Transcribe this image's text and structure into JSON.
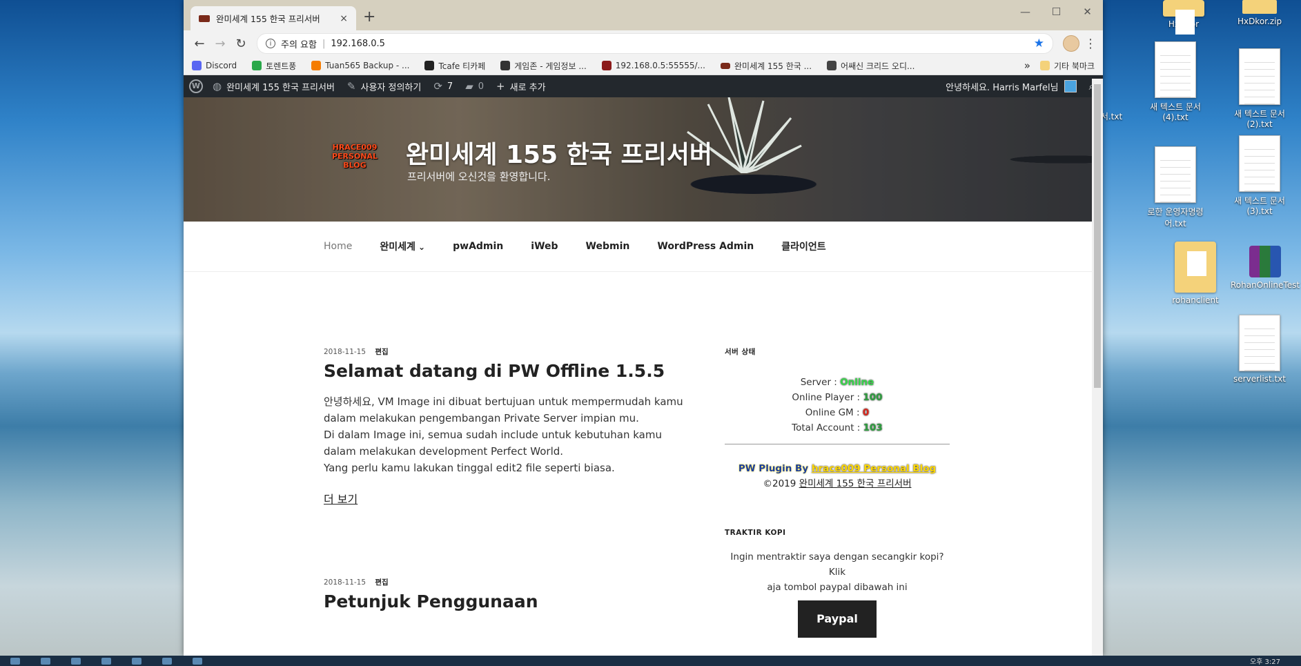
{
  "browser": {
    "tab_title": "완미세계 155 한국 프리서버",
    "tab_close": "×",
    "new_tab": "+",
    "url_warning": "주의 요함",
    "url": "192.168.0.5",
    "minimize": "—",
    "maximize": "☐",
    "close": "✕"
  },
  "bookmarks": {
    "items": [
      {
        "label": "Discord",
        "color": "#5865f2"
      },
      {
        "label": "토렌트풍",
        "color": "#2aa84a"
      },
      {
        "label": "Tuan565 Backup - ...",
        "color": "#f57c00"
      },
      {
        "label": "Tcafe 티카페",
        "color": "#222222"
      },
      {
        "label": "게임존 - 게임정보 ...",
        "color": "#333333"
      },
      {
        "label": "192.168.0.5:55555/...",
        "color": "#8b1a1a"
      },
      {
        "label": "완미세계 155 한국 ...",
        "color": "#7a2a1a"
      },
      {
        "label": "어쌔신 크리드 오디...",
        "color": "#444444"
      }
    ],
    "more": "»",
    "other": "기타 북마크"
  },
  "adminbar": {
    "site": "완미세계 155 한국 프리서버",
    "customize": "사용자 정의하기",
    "updates": "7",
    "comments": "0",
    "new": "새로 추가",
    "greeting": "안녕하세요. Harris Marfel님"
  },
  "header": {
    "logo_line1": "HRACE009",
    "logo_line2": "PERSONAL",
    "logo_line3": "BLOG",
    "title": "완미세계 155 한국 프리서버",
    "description": "프리서버에 오신것을 환영합니다."
  },
  "nav": [
    "Home",
    "완미세계",
    "pwAdmin",
    "iWeb",
    "Webmin",
    "WordPress Admin",
    "클라이언트"
  ],
  "posts": [
    {
      "date": "2018-11-15",
      "edit": "편집",
      "title": "Selamat datang di PW Offline 1.5.5",
      "lines": [
        "안녕하세요, VM Image ini dibuat bertujuan untuk mempermudah kamu",
        "dalam melakukan pengembangan Private Server impian mu.",
        "Di dalam Image ini, semua sudah include untuk kebutuhan kamu",
        "dalam melakukan development Perfect World.",
        "Yang perlu kamu lakukan tinggal edit2 file seperti biasa."
      ],
      "more": "더 보기"
    },
    {
      "date": "2018-11-15",
      "edit": "편집",
      "title": "Petunjuk Penggunaan"
    }
  ],
  "sidebar": {
    "status_title": "서버 상태",
    "server_label": "Server : ",
    "server_value": "Online",
    "player_label": "Online Player : ",
    "player_value": "100",
    "gm_label": "Online GM : ",
    "gm_value": "0",
    "account_label": "Total Account : ",
    "account_value": "103",
    "plugin_prefix": "PW Plugin By ",
    "plugin_link": "hrace009 Personal Blog",
    "copyright_prefix": "©2019 ",
    "copyright_link": "완미세계 155 한국 프리서버",
    "kopi_title": "TRAKTIR KOPI",
    "kopi_line1": "Ingin mentraktir saya dengan secangkir kopi? Klik",
    "kopi_line2": "aja tombol paypal dibawah ini",
    "paypal": "Paypal"
  },
  "desktop": {
    "icons": [
      {
        "label": "HxDkor"
      },
      {
        "label": "HxDkor.zip"
      },
      {
        "label": "새 텍스트 문서 (4).txt"
      },
      {
        "label": "새 텍스트 문서 (2).txt"
      },
      {
        "label": "로한 운영자명령어.txt"
      },
      {
        "label": "새 텍스트 문서 (3).txt"
      },
      {
        "label": "rohanclient"
      },
      {
        "label": "RohanOnlineTest"
      },
      {
        "label": "serverlist.txt"
      },
      {
        "label": "문서.txt"
      }
    ]
  },
  "taskbar": {
    "clock": "오후 3:27"
  },
  "colors": {
    "online": "#38d64b",
    "value_green": "#2e9e3f",
    "value_red": "#d9261c",
    "admin_bar": "#23282d"
  }
}
